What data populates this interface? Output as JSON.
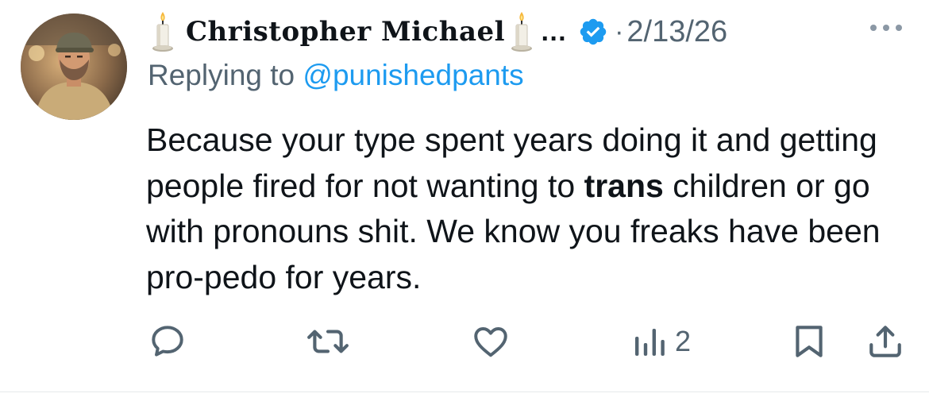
{
  "tweet": {
    "author": {
      "display_name": "Christopher Michael",
      "truncation": "…",
      "verified_icon": "verified-badge-icon",
      "separator": "·",
      "date": "2/13/26"
    },
    "reply": {
      "prefix": "Replying to ",
      "handle": "@punishedpants"
    },
    "body": {
      "part1": "Because your type spent years doing it and getting people fired for not wanting to ",
      "bold": "trans",
      "part2": " children or go with pronouns shit.  We know you freaks have been pro-pedo for years."
    },
    "actions": {
      "reply_icon": "reply-icon",
      "retweet_icon": "retweet-icon",
      "like_icon": "heart-icon",
      "views_icon": "views-chart-icon",
      "views_count": "2",
      "bookmark_icon": "bookmark-icon",
      "share_icon": "share-icon"
    },
    "colors": {
      "text": "#0f1419",
      "secondary": "#536471",
      "accent": "#1d9bf0"
    }
  }
}
